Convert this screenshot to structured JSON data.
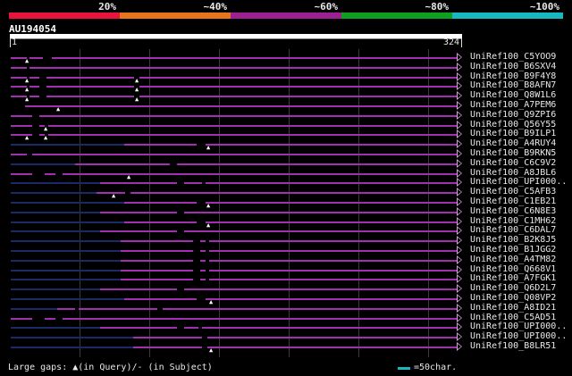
{
  "identity_bands": [
    {
      "label": "20%",
      "color": "#e8143c"
    },
    {
      "label": "~40%",
      "color": "#e8741c"
    },
    {
      "label": "~60%",
      "color": "#9c2090"
    },
    {
      "label": "~80%",
      "color": "#10a020"
    },
    {
      "label": "~100%",
      "color": "#18b8c0"
    }
  ],
  "query": {
    "id": "AU194054",
    "start": "1",
    "end": "324"
  },
  "colors": {
    "hit": "#a030b0",
    "faint": "#1a2a66",
    "swatch": "#18b8c0"
  },
  "hits": [
    {
      "name": "UniRef100_C5YOO9"
    },
    {
      "name": "UniRef100_B6SXV4"
    },
    {
      "name": "UniRef100_B9F4Y8"
    },
    {
      "name": "UniRef100_B8AFN7"
    },
    {
      "name": "UniRef100_Q8W1L6"
    },
    {
      "name": "UniRef100_A7PEM6"
    },
    {
      "name": "UniRef100_Q9ZPI6"
    },
    {
      "name": "UniRef100_Q56Y55"
    },
    {
      "name": "UniRef100_B9ILP1"
    },
    {
      "name": "UniRef100_A4RUY4"
    },
    {
      "name": "UniRef100_B9RKN5"
    },
    {
      "name": "UniRef100_C6C9V2"
    },
    {
      "name": "UniRef100_A8JBL6"
    },
    {
      "name": "UniRef100_UPI000.."
    },
    {
      "name": "UniRef100_C5AFB3"
    },
    {
      "name": "UniRef100_C1EB21"
    },
    {
      "name": "UniRef100_C6N8E3"
    },
    {
      "name": "UniRef100_C1MH62"
    },
    {
      "name": "UniRef100_C6DAL7"
    },
    {
      "name": "UniRef100_B2K8J5"
    },
    {
      "name": "UniRef100_B1JGG2"
    },
    {
      "name": "UniRef100_A4TM82"
    },
    {
      "name": "UniRef100_Q668V1"
    },
    {
      "name": "UniRef100_A7FGK1"
    },
    {
      "name": "UniRef100_Q6D2L7"
    },
    {
      "name": "UniRef100_Q08VP2"
    },
    {
      "name": "UniRef100_A8ID21"
    },
    {
      "name": "UniRef100_C5AD51"
    },
    {
      "name": "UniRef100_UPI000.."
    },
    {
      "name": "UniRef100_UPI000.."
    },
    {
      "name": "UniRef100_B8LR51"
    }
  ],
  "legend": {
    "text": "Large gaps: ▲(in Query)/- (in Subject)",
    "unit": "=50char."
  }
}
